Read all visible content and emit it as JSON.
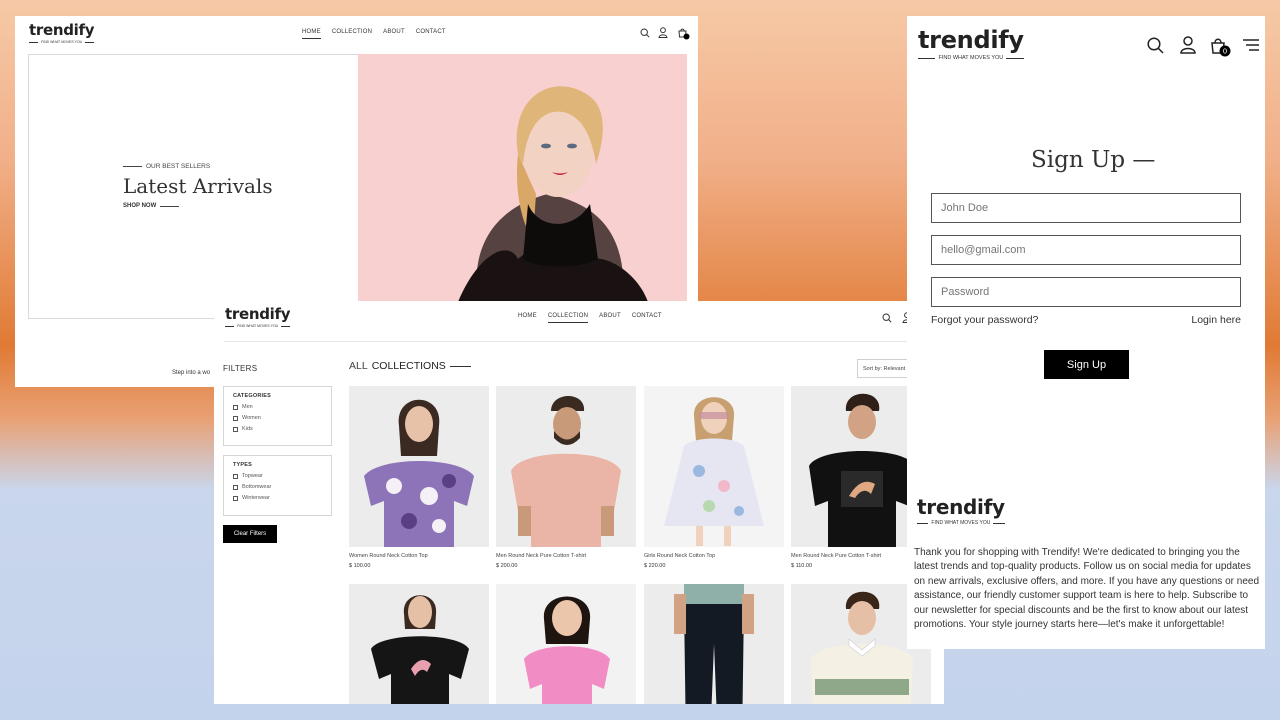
{
  "brand": {
    "name": "trendify",
    "tagline": "FIND WHAT MOVES YOU"
  },
  "nav": {
    "home": "HOME",
    "collection": "COLLECTION",
    "about": "ABOUT",
    "contact": "CONTACT"
  },
  "hero": {
    "eyebrow": "OUR BEST SELLERS",
    "title": "Latest Arrivals",
    "cta": "SHOP NOW",
    "footer_text": "Step into a wo"
  },
  "cart": {
    "count": "0"
  },
  "collection": {
    "filters_title": "FILTERS",
    "categories": {
      "heading": "CATEGORIES",
      "options": [
        "Men",
        "Women",
        "Kids"
      ]
    },
    "types": {
      "heading": "TYPES",
      "options": [
        "Topwear",
        "Bottomwear",
        "Winterwear"
      ]
    },
    "clear_label": "Clear Filters",
    "heading_prefix": "ALL",
    "heading_main": "COLLECTIONS",
    "sort_label": "Sort by: Relevant",
    "products": [
      {
        "name": "Women Round Neck Cotton Top",
        "price": "$ 100.00"
      },
      {
        "name": "Men Round Neck Pure Cotton T-shirt",
        "price": "$ 200.00"
      },
      {
        "name": "Girls Round Neck Cotton Top",
        "price": "$ 220.00"
      },
      {
        "name": "Men Round Neck Pure Cotton T-shirt",
        "price": "$ 110.00"
      }
    ]
  },
  "signup": {
    "title": "Sign Up —",
    "name_placeholder": "John Doe",
    "email_placeholder": "hello@gmail.com",
    "password_placeholder": "Password",
    "forgot": "Forgot your password?",
    "login": "Login here",
    "button": "Sign Up"
  },
  "footer": {
    "about": "Thank you for shopping with Trendify! We're dedicated to bringing you the latest trends and top-quality products. Follow us on social media for updates on new arrivals, exclusive offers, and more. If you have any questions or need assistance, our friendly customer support team is here to help. Subscribe to our newsletter for special discounts and be the first to know about our latest promotions. Your style journey starts here—let's make it unforgettable!"
  },
  "colors": {
    "accent": "#000000",
    "hero_bg": "#f8d0cf",
    "brand_t": "#8a5a2b"
  },
  "icons": [
    "search-icon",
    "user-icon",
    "cart-icon",
    "menu-icon"
  ]
}
